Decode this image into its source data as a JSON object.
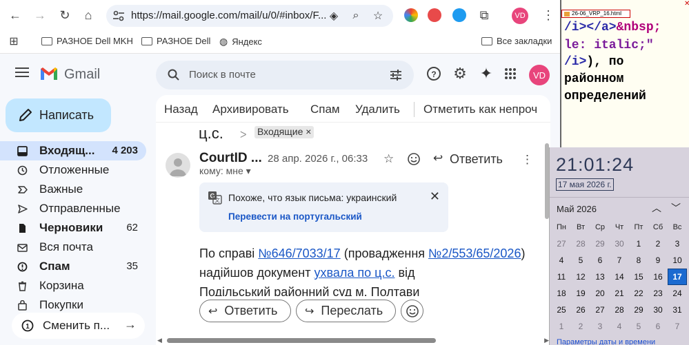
{
  "browser": {
    "url": "https://mail.google.com/mail/u/0/#inbox/F...",
    "profile_initials": "VD",
    "bookmarks": [
      "РАЗНОЕ Dell MKH",
      "РАЗНОЕ Dell",
      "Яндекс"
    ],
    "all_bookmarks": "Все закладки"
  },
  "gmail": {
    "wordmark": "Gmail",
    "search_placeholder": "Поиск в почте",
    "profile_initials": "VD",
    "compose": "Написать",
    "nav": [
      {
        "label": "Входящ...",
        "count": "4 203",
        "icon": "inbox-icon"
      },
      {
        "label": "Отложенные",
        "count": "",
        "icon": "snooze-icon"
      },
      {
        "label": "Важные",
        "count": "",
        "icon": "important-icon"
      },
      {
        "label": "Отправленные",
        "count": "",
        "icon": "sent-icon"
      },
      {
        "label": "Черновики",
        "count": "62",
        "icon": "draft-icon"
      },
      {
        "label": "Вся почта",
        "count": "",
        "icon": "all-mail-icon"
      },
      {
        "label": "Спам",
        "count": "35",
        "icon": "spam-icon"
      },
      {
        "label": "Корзина",
        "count": "",
        "icon": "trash-icon"
      },
      {
        "label": "Покупки",
        "count": "",
        "icon": "purchases-icon"
      }
    ],
    "switch_account": "Сменить п...",
    "actions": [
      "Назад",
      "Архивировать",
      "Спам",
      "Удалить",
      "Отметить как непроч"
    ],
    "message": {
      "subject_fragment": "ц.с.",
      "label": "Входящие ×",
      "sender": "CourtID ...",
      "date": "28 апр. 2026 г., 06:33",
      "reply": "Ответить",
      "to": "кому: мне ▾",
      "translate_notice": "Похоже, что язык письма: украинский",
      "translate_link": "Перевести на португальский",
      "body_prefix": "По справі ",
      "body_case_link": "№646/7033/17",
      "body_mid": " (провадження ",
      "body_proc_link": "№2/553/65/2026",
      "body_mid2": ") надійшов документ ",
      "body_doc_link": "ухвала по ц.с.",
      "body_suffix": " від",
      "body_line3": "Подільський районний суд м. Полтави"
    },
    "reply_button": "Ответить",
    "forward_button": "Переслать"
  },
  "editor": {
    "tab_name": "26-06_VRP_16.html",
    "lines": [
      {
        "parts": [
          [
            "/i></a>",
            "tag"
          ],
          [
            "&nbsp;",
            "ent"
          ]
        ]
      },
      {
        "parts": [
          [
            "le: italic;\"",
            "attr"
          ]
        ]
      },
      {
        "parts": [
          [
            "/i>",
            "tag"
          ],
          [
            "), по",
            "txt"
          ]
        ]
      },
      {
        "parts": [
          [
            "районном",
            "txt"
          ]
        ]
      },
      {
        "parts": [
          [
            "определений",
            "txt"
          ]
        ]
      }
    ]
  },
  "calendar": {
    "time": "21:01:24",
    "date": "17 мая 2026 г.",
    "month": "Май 2026",
    "weekdays": [
      "Пн",
      "Вт",
      "Ср",
      "Чт",
      "Пт",
      "Сб",
      "Вс"
    ],
    "weeks": [
      [
        [
          "27",
          true
        ],
        [
          "28",
          true
        ],
        [
          "29",
          true
        ],
        [
          "30",
          true
        ],
        [
          "1",
          false
        ],
        [
          "2",
          false
        ],
        [
          "3",
          false
        ]
      ],
      [
        [
          "4",
          false
        ],
        [
          "5",
          false
        ],
        [
          "6",
          false
        ],
        [
          "7",
          false
        ],
        [
          "8",
          false
        ],
        [
          "9",
          false
        ],
        [
          "10",
          false
        ]
      ],
      [
        [
          "11",
          false
        ],
        [
          "12",
          false
        ],
        [
          "13",
          false
        ],
        [
          "14",
          false
        ],
        [
          "15",
          false
        ],
        [
          "16",
          false
        ],
        [
          "17",
          false
        ]
      ],
      [
        [
          "18",
          false
        ],
        [
          "19",
          false
        ],
        [
          "20",
          false
        ],
        [
          "21",
          false
        ],
        [
          "22",
          false
        ],
        [
          "23",
          false
        ],
        [
          "24",
          false
        ]
      ],
      [
        [
          "25",
          false
        ],
        [
          "26",
          false
        ],
        [
          "27",
          false
        ],
        [
          "28",
          false
        ],
        [
          "29",
          false
        ],
        [
          "30",
          false
        ],
        [
          "31",
          false
        ]
      ],
      [
        [
          "1",
          true
        ],
        [
          "2",
          true
        ],
        [
          "3",
          true
        ],
        [
          "4",
          true
        ],
        [
          "5",
          true
        ],
        [
          "6",
          true
        ],
        [
          "7",
          true
        ]
      ]
    ],
    "today": "17",
    "settings_link": "Параметры даты и времени"
  }
}
